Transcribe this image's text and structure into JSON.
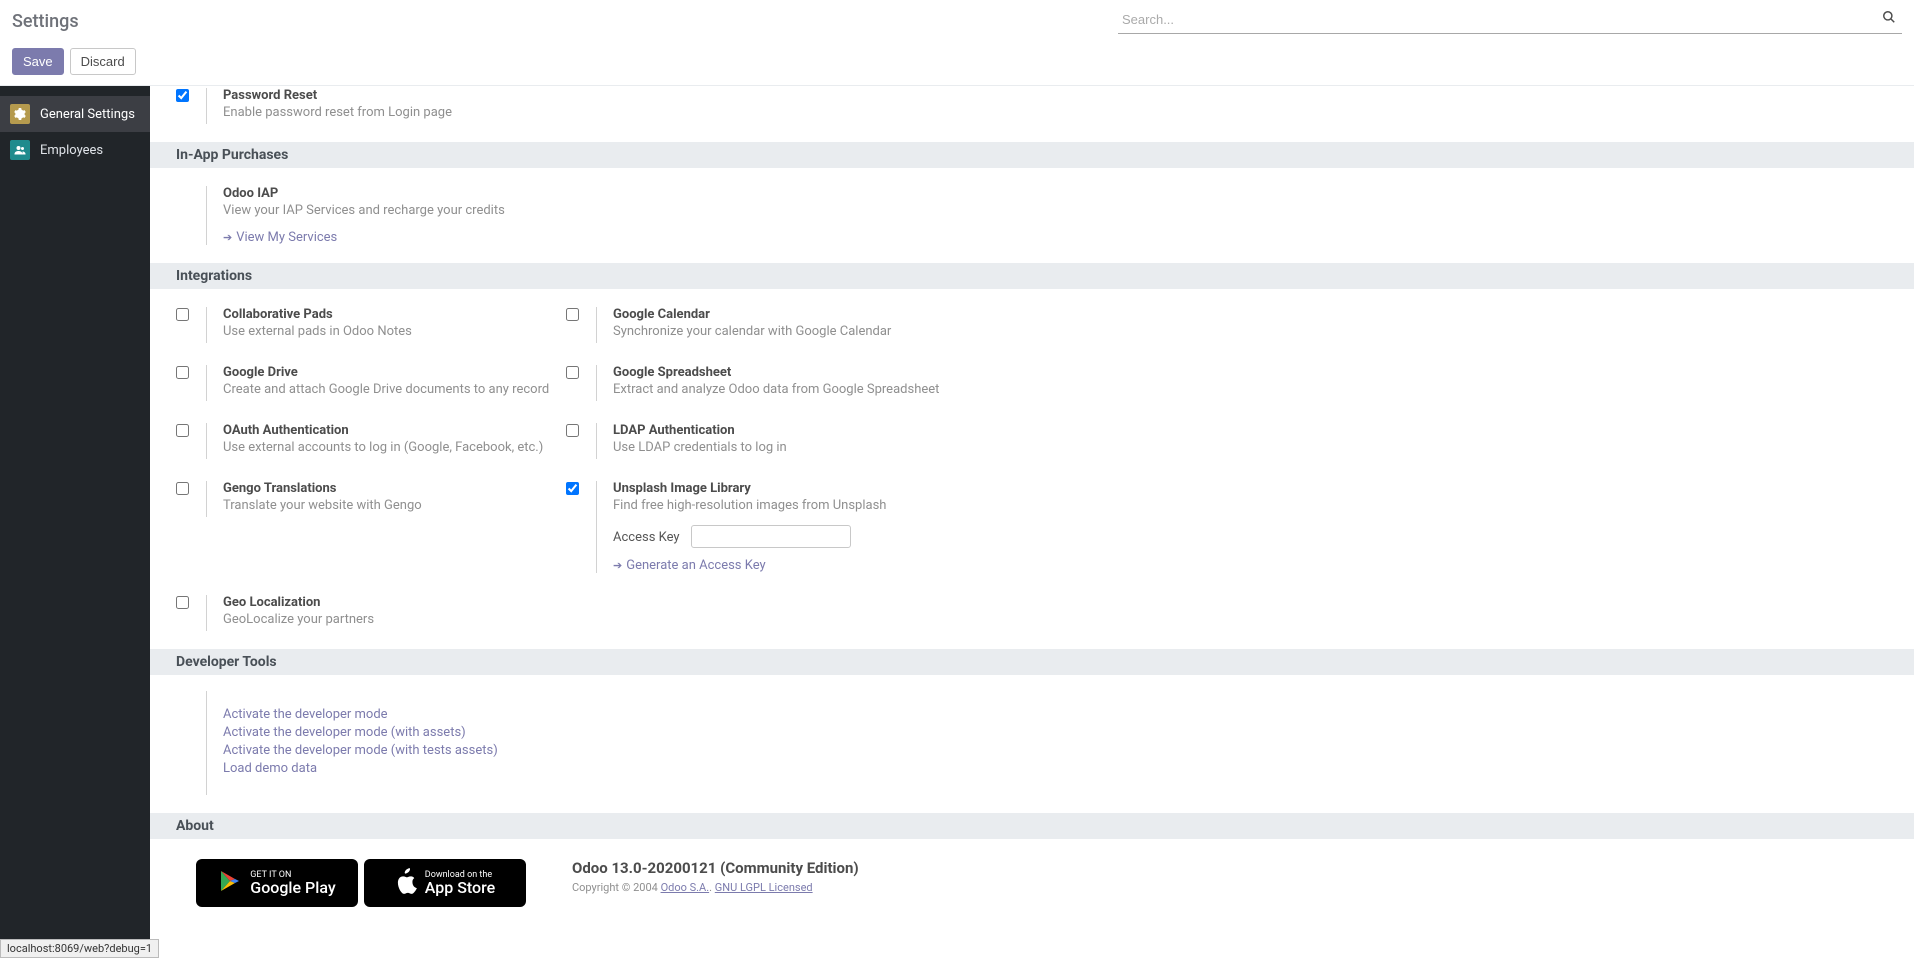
{
  "header": {
    "title": "Settings",
    "search_placeholder": "Search..."
  },
  "toolbar": {
    "save": "Save",
    "discard": "Discard"
  },
  "sidebar": {
    "general": "General Settings",
    "employees": "Employees"
  },
  "sections": {
    "iap": "In-App Purchases",
    "integrations": "Integrations",
    "dev": "Developer Tools",
    "about": "About"
  },
  "partial": {
    "password_reset": {
      "title": "Password Reset",
      "desc": "Enable password reset from Login page",
      "checked": true
    }
  },
  "iap": {
    "title": "Odoo IAP",
    "desc": "View your IAP Services and recharge your credits",
    "view_my_services": "View My Services"
  },
  "integrations": {
    "collab_pads": {
      "title": "Collaborative Pads",
      "desc": "Use external pads in Odoo Notes",
      "checked": false
    },
    "google_cal": {
      "title": "Google Calendar",
      "desc": "Synchronize your calendar with Google Calendar",
      "checked": false
    },
    "google_drive": {
      "title": "Google Drive",
      "desc": "Create and attach Google Drive documents to any record",
      "checked": false
    },
    "google_sheet": {
      "title": "Google Spreadsheet",
      "desc": "Extract and analyze Odoo data from Google Spreadsheet",
      "checked": false
    },
    "oauth": {
      "title": "OAuth Authentication",
      "desc": "Use external accounts to log in (Google, Facebook, etc.)",
      "checked": false
    },
    "ldap": {
      "title": "LDAP Authentication",
      "desc": "Use LDAP credentials to log in",
      "checked": false
    },
    "gengo": {
      "title": "Gengo Translations",
      "desc": "Translate your website with Gengo",
      "checked": false
    },
    "unsplash": {
      "title": "Unsplash Image Library",
      "desc": "Find free high-resolution images from Unsplash",
      "checked": true,
      "access_key_label": "Access Key",
      "access_key_value": "",
      "generate_link": "Generate an Access Key"
    },
    "geo": {
      "title": "Geo Localization",
      "desc": "GeoLocalize your partners",
      "checked": false
    }
  },
  "dev": {
    "activate": "Activate the developer mode",
    "activate_assets": "Activate the developer mode (with assets)",
    "activate_tests": "Activate the developer mode (with tests assets)",
    "load_demo": "Load demo data"
  },
  "store": {
    "google_small": "GET IT ON",
    "google_big": "Google Play",
    "apple_small": "Download on the",
    "apple_big": "App Store"
  },
  "about": {
    "version": "Odoo 13.0-20200121 (Community Edition)",
    "copyright_prefix": "Copyright © 2004 ",
    "odoo_sa": "Odoo S.A.",
    "license": "GNU LGPL Licensed"
  },
  "status": {
    "url": "localhost:8069/web?debug=1"
  }
}
